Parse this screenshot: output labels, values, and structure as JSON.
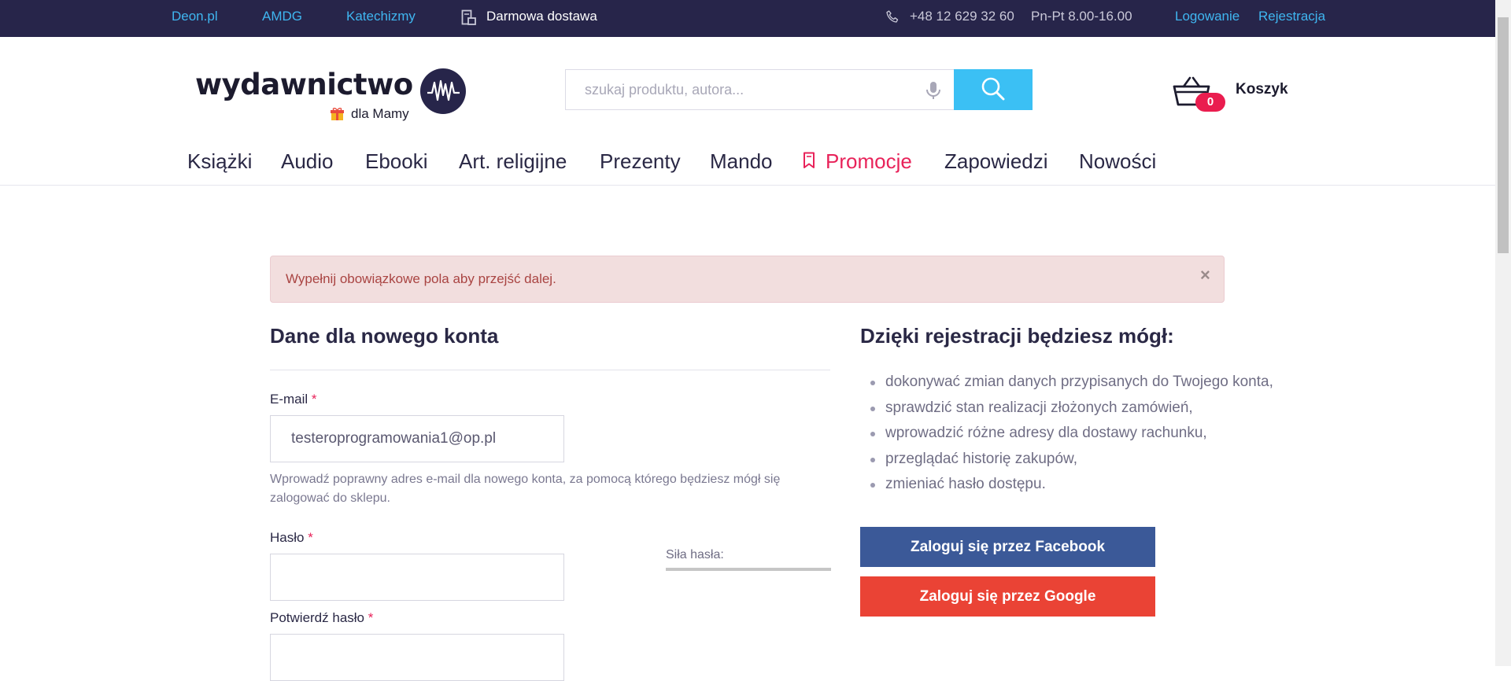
{
  "topbar": {
    "links": [
      "Deon.pl",
      "AMDG",
      "Katechizmy"
    ],
    "delivery": "Darmowa dostawa",
    "phone": "+48 12 629 32 60",
    "hours": "Pn-Pt 8.00-16.00",
    "login": "Logowanie",
    "register": "Rejestracja"
  },
  "header": {
    "logo_text": "wydawnictwo",
    "logo_sub": "dla Mamy",
    "search_placeholder": "szukaj produktu, autora...",
    "cart_count": "0",
    "cart_label": "Koszyk"
  },
  "nav": [
    "Książki",
    "Audio",
    "Ebooki",
    "Art. religijne",
    "Prezenty",
    "Mando",
    "Promocje",
    "Zapowiedzi",
    "Nowości"
  ],
  "alert": {
    "text": "Wypełnij obowiązkowe pola aby przejść dalej.",
    "close": "×"
  },
  "form": {
    "title": "Dane dla nowego konta",
    "email_label": "E-mail",
    "email_value": "testeroprogramowania1@op.pl",
    "email_hint": "Wprowadź poprawny adres e-mail dla nowego konta, za pomocą którego będziesz mógł się zalogować do sklepu.",
    "password_label": "Hasło",
    "password_value": "",
    "strength_label": "Siła hasła:",
    "confirm_label": "Potwierdź hasło",
    "confirm_value": "",
    "required_mark": "*"
  },
  "benefits": {
    "title": "Dzięki rejestracji będziesz mógł:",
    "items": [
      "dokonywać zmian danych przypisanych do Twojego konta,",
      "sprawdzić stan realizacji złożonych zamówień,",
      "wprowadzić różne adresy dla dostawy rachunku,",
      "przeglądać historię zakupów,",
      "zmieniać hasło dostępu."
    ]
  },
  "social": {
    "facebook": "Zaloguj się przez Facebook",
    "google": "Zaloguj się przez Google"
  },
  "colors": {
    "topbar_bg": "#27254a",
    "accent_blue": "#3bc0f4",
    "accent_pink": "#e8235a",
    "facebook": "#3b5998",
    "google": "#ea4335",
    "alert_bg": "#f2dede",
    "alert_text": "#a94442"
  },
  "icons": [
    "truck-box-icon",
    "phone-icon",
    "logo-badge-icon",
    "gift-icon",
    "microphone-icon",
    "search-icon",
    "basket-icon",
    "bookmark-icon",
    "close-icon",
    "bullet-dot"
  ]
}
